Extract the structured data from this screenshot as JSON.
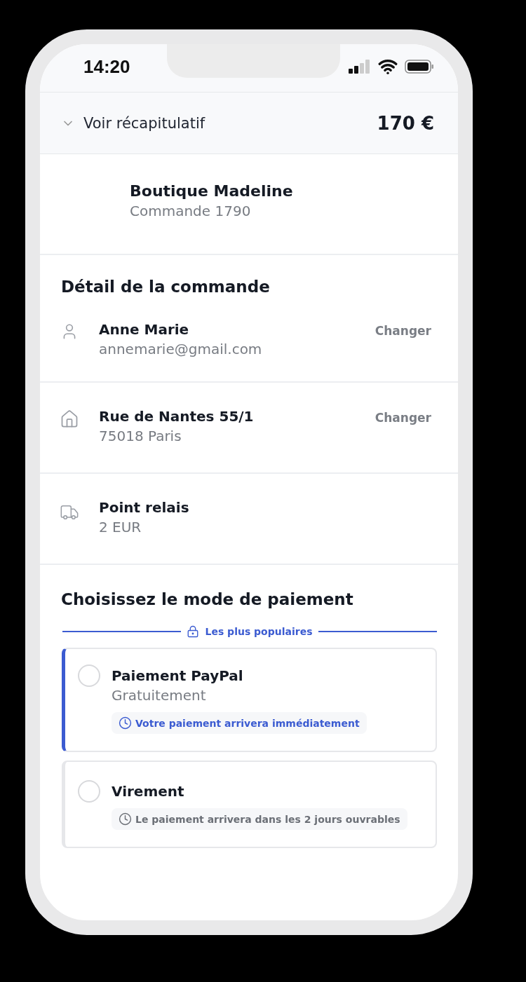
{
  "status_bar": {
    "time": "14:20"
  },
  "summary": {
    "label": "Voir récapitulatif",
    "expanded": false,
    "total": "170 €"
  },
  "shop": {
    "name": "Boutique Madeline",
    "order": "Commande 1790"
  },
  "details": {
    "title": "Détail de la commande",
    "rows": [
      {
        "kind": "person",
        "title": "Anne Marie",
        "subtitle": "annemarie@gmail.com",
        "action": "Changer"
      },
      {
        "kind": "address",
        "title": "Rue de Nantes 55/1",
        "subtitle": "75018 Paris",
        "action": "Changer"
      },
      {
        "kind": "delivery",
        "title": "Point relais",
        "subtitle": "2 EUR"
      }
    ]
  },
  "payment": {
    "title": "Choisissez le mode de paiement",
    "divider_label": "Les plus populaires",
    "methods": [
      {
        "name": "Paiement PayPal",
        "price": "Gratuitement",
        "note": "Votre paiement arrivera immédiatement",
        "featured": true,
        "selected": false
      },
      {
        "name": "Virement",
        "note": "Le paiement arrivera dans les 2 jours ouvrables",
        "featured": false,
        "selected": false
      }
    ]
  }
}
